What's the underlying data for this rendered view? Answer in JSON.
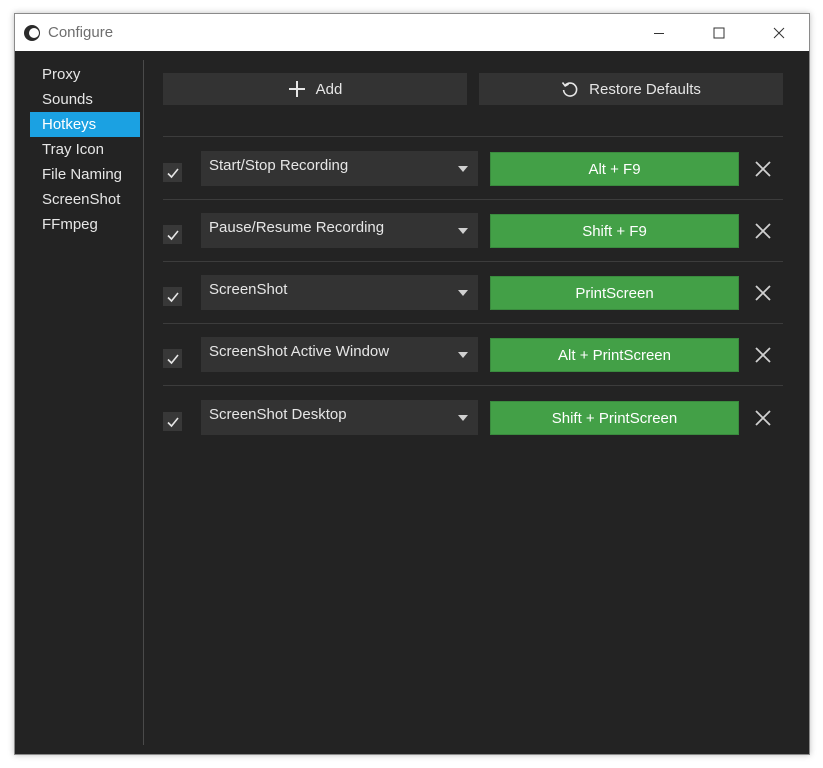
{
  "window": {
    "title": "Configure"
  },
  "sidebar": {
    "items": [
      {
        "label": "Proxy",
        "active": false
      },
      {
        "label": "Sounds",
        "active": false
      },
      {
        "label": "Hotkeys",
        "active": true
      },
      {
        "label": "Tray Icon",
        "active": false
      },
      {
        "label": "File Naming",
        "active": false
      },
      {
        "label": "ScreenShot",
        "active": false
      },
      {
        "label": "FFmpeg",
        "active": false
      }
    ]
  },
  "toolbar": {
    "add_label": "Add",
    "restore_label": "Restore Defaults"
  },
  "hotkeys": [
    {
      "enabled": true,
      "action": "Start/Stop Recording",
      "keys": "Alt + F9"
    },
    {
      "enabled": true,
      "action": "Pause/Resume Recording",
      "keys": "Shift + F9"
    },
    {
      "enabled": true,
      "action": "ScreenShot",
      "keys": "PrintScreen"
    },
    {
      "enabled": true,
      "action": "ScreenShot Active Window",
      "keys": "Alt + PrintScreen"
    },
    {
      "enabled": true,
      "action": "ScreenShot Desktop",
      "keys": "Shift + PrintScreen"
    }
  ],
  "colors": {
    "accent": "#1ba1e2",
    "hotkey_bg": "#43a047",
    "background": "#232323"
  }
}
